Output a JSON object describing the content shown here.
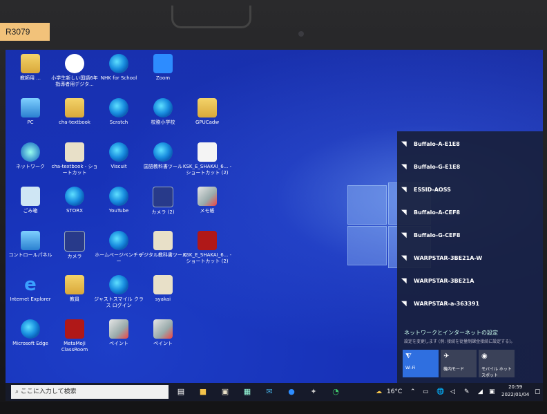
{
  "asset_tag": "R3079",
  "desktop_icons": [
    {
      "label": "教師用 ...",
      "kind": "folder",
      "col": 0,
      "row": 0
    },
    {
      "label": "小学生新しい国語6年 指導者用デジタ...",
      "kind": "nhk",
      "col": 1,
      "row": 0
    },
    {
      "label": "NHK for School",
      "kind": "edge",
      "col": 2,
      "row": 0
    },
    {
      "label": "Zoom",
      "kind": "zoom",
      "col": 3,
      "row": 0
    },
    {
      "label": "PC",
      "kind": "pc",
      "col": 0,
      "row": 1
    },
    {
      "label": "cha-textbook",
      "kind": "folder",
      "col": 1,
      "row": 1
    },
    {
      "label": "Scratch",
      "kind": "edge",
      "col": 2,
      "row": 1
    },
    {
      "label": "校務小学校",
      "kind": "edge",
      "col": 3,
      "row": 1
    },
    {
      "label": "GPUCadw",
      "kind": "folder",
      "col": 4,
      "row": 1
    },
    {
      "label": "ネットワーク",
      "kind": "net",
      "col": 0,
      "row": 2
    },
    {
      "label": "cha-textbook - ショートカット",
      "kind": "book",
      "col": 1,
      "row": 2
    },
    {
      "label": "Viscuit",
      "kind": "edge",
      "col": 2,
      "row": 2
    },
    {
      "label": "国語教科書ツール",
      "kind": "edge",
      "col": 3,
      "row": 2
    },
    {
      "label": "KSK_E_SHAKAI_6... - ショートカット (2)",
      "kind": "doc",
      "col": 4,
      "row": 2
    },
    {
      "label": "ごみ箱",
      "kind": "bin",
      "col": 0,
      "row": 3
    },
    {
      "label": "STORX",
      "kind": "edge",
      "col": 1,
      "row": 3
    },
    {
      "label": "YouTube",
      "kind": "edge",
      "col": 2,
      "row": 3
    },
    {
      "label": "カメラ (2)",
      "kind": "cam",
      "col": 3,
      "row": 3
    },
    {
      "label": "メモ帳",
      "kind": "paint",
      "col": 4,
      "row": 3
    },
    {
      "label": "コントロールパネル",
      "kind": "pc",
      "col": 0,
      "row": 4
    },
    {
      "label": "カメラ",
      "kind": "cam",
      "col": 1,
      "row": 4
    },
    {
      "label": "ホームページベンチャー",
      "kind": "edge",
      "col": 2,
      "row": 4
    },
    {
      "label": "デジタル教科書ツール",
      "kind": "book",
      "col": 3,
      "row": 4
    },
    {
      "label": "KSK_E_SHAKAI_6... - ショートカット (2)",
      "kind": "red",
      "col": 4,
      "row": 4
    },
    {
      "label": "Internet Explorer",
      "kind": "ie",
      "col": 0,
      "row": 5
    },
    {
      "label": "教員",
      "kind": "folder",
      "col": 1,
      "row": 5
    },
    {
      "label": "ジャストスマイル クラス ログイン",
      "kind": "edge",
      "col": 2,
      "row": 5
    },
    {
      "label": "syakai",
      "kind": "book",
      "col": 3,
      "row": 5
    },
    {
      "label": "Microsoft Edge",
      "kind": "edge",
      "col": 0,
      "row": 6
    },
    {
      "label": "MetaMoJi ClassRoom",
      "kind": "red",
      "col": 1,
      "row": 6
    },
    {
      "label": "ペイント",
      "kind": "paint",
      "col": 2,
      "row": 6
    },
    {
      "label": "ペイント",
      "kind": "paint",
      "col": 3,
      "row": 6
    }
  ],
  "networks": [
    {
      "name": "Buffalo-A-E1E8",
      "secured": true
    },
    {
      "name": "Buffalo-G-E1E8",
      "secured": true
    },
    {
      "name": "ESSID-AOSS",
      "secured": false
    },
    {
      "name": "Buffalo-A-CEF8",
      "secured": true
    },
    {
      "name": "Buffalo-G-CEF8",
      "secured": true
    },
    {
      "name": "WARPSTAR-3BE21A-W",
      "secured": true
    },
    {
      "name": "WARPSTAR-3BE21A",
      "secured": true
    },
    {
      "name": "WARPSTAR-a-363391",
      "secured": true
    }
  ],
  "network_settings": {
    "title": "ネットワークとインターネットの設定",
    "subtitle": "設定を変更します (例: 接続を従量制課金接続に設定する)。"
  },
  "quick_tiles": [
    {
      "label": "Wi-Fi",
      "icon": "wifi-icon",
      "active": true
    },
    {
      "label": "機内モード",
      "icon": "airplane-icon",
      "active": false
    },
    {
      "label": "モバイル ホットスポット",
      "icon": "hotspot-icon",
      "active": false
    }
  ],
  "taskbar": {
    "search_placeholder": "ここに入力して検索",
    "temperature": "16°C",
    "time": "20:59",
    "date": "2022/01/04"
  },
  "colors": {
    "wifi_tile_active": "#2f6fe0",
    "tile_inactive": "#3a4158",
    "desktop_blue": "#1f3fd0"
  }
}
